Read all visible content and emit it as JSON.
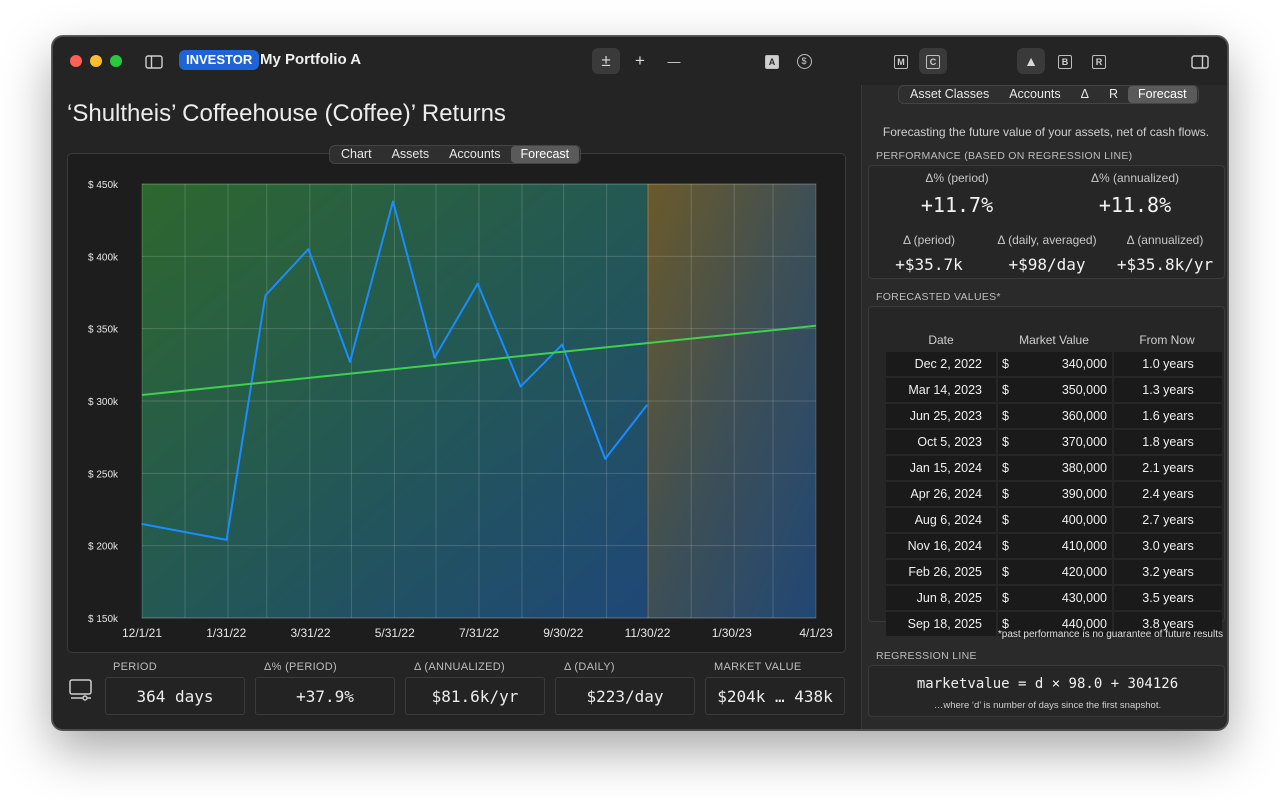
{
  "app": {
    "badge": "INVESTOR",
    "portfolio_name": "My Portfolio A",
    "accent_color": "#1f64d4"
  },
  "toolbar": {
    "icons": [
      "sidebar-toggle-icon",
      "plus-minus-icon",
      "plus-icon",
      "minus-icon",
      "a-box-icon",
      "dollar-circle-icon",
      "m-box-icon",
      "c-box-icon",
      "triangle-icon",
      "b-box-icon",
      "r-box-icon",
      "inspector-toggle-icon"
    ],
    "plus_minus": "±",
    "plus": "+",
    "minus": "—",
    "box_a": "A",
    "dollar": "$",
    "box_m": "M",
    "box_c": "C",
    "triangle": "▲",
    "box_b": "B",
    "box_r": "R"
  },
  "main": {
    "title": "‘Shultheis’ Coffeehouse (Coffee)’ Returns",
    "tabs": [
      {
        "label": "Chart",
        "active": false
      },
      {
        "label": "Assets",
        "active": false
      },
      {
        "label": "Accounts",
        "active": false
      },
      {
        "label": "Forecast",
        "active": true
      }
    ]
  },
  "chart_data": {
    "type": "line",
    "x_ticks": [
      "12/1/21",
      "1/31/22",
      "3/31/22",
      "5/31/22",
      "7/31/22",
      "9/30/22",
      "11/30/22",
      "1/30/23",
      "4/1/23"
    ],
    "y_ticks": [
      "$  450k",
      "$  400k",
      "$  350k",
      "$  300k",
      "$  250k",
      "$  200k",
      "$  150k"
    ],
    "ylim": [
      150000,
      450000
    ],
    "xlim": [
      "2021-12-01",
      "2023-04-01"
    ],
    "forecast_region_start": "2022-11-30",
    "series": [
      {
        "type": "market-value",
        "color": "#1a8cff",
        "points": [
          [
            "2021-12-01",
            215000
          ],
          [
            "2022-01-31",
            204000
          ],
          [
            "2022-02-28",
            373000
          ],
          [
            "2022-03-31",
            405000
          ],
          [
            "2022-04-30",
            327000
          ],
          [
            "2022-05-31",
            438000
          ],
          [
            "2022-06-30",
            330000
          ],
          [
            "2022-07-31",
            381000
          ],
          [
            "2022-08-31",
            310000
          ],
          [
            "2022-09-30",
            339000
          ],
          [
            "2022-10-31",
            260000
          ],
          [
            "2022-11-30",
            297000
          ]
        ]
      },
      {
        "type": "regression",
        "color": "#3fd04e",
        "points": [
          [
            "2021-12-01",
            304126
          ],
          [
            "2023-04-01",
            352000
          ]
        ]
      }
    ]
  },
  "stats": {
    "icon": "desktop-icon",
    "items": [
      {
        "label": "PERIOD",
        "value": "364 days"
      },
      {
        "label": "Δ% (PERIOD)",
        "value": "+37.9%"
      },
      {
        "label": "Δ (ANNUALIZED)",
        "value": "$81.6k/yr"
      },
      {
        "label": "Δ (DAILY)",
        "value": "$223/day"
      },
      {
        "label": "MARKET VALUE",
        "value": "$204k … 438k"
      }
    ]
  },
  "sidebar": {
    "tabs": [
      {
        "label": "Asset Classes",
        "active": false
      },
      {
        "label": "Accounts",
        "active": false
      },
      {
        "label": "Δ",
        "active": false
      },
      {
        "label": "R",
        "active": false
      },
      {
        "label": "Forecast",
        "active": true
      }
    ],
    "description": "Forecasting the future value of your assets, net of cash flows.",
    "performance": {
      "heading": "PERFORMANCE (BASED ON REGRESSION LINE)",
      "pct_period_label": "Δ% (period)",
      "pct_period": "+11.7%",
      "pct_annual_label": "Δ% (annualized)",
      "pct_annual": "+11.8%",
      "d_period_label": "Δ (period)",
      "d_period": "+$35.7k",
      "d_daily_label": "Δ (daily, averaged)",
      "d_daily": "+$98/day",
      "d_annual_label": "Δ (annualized)",
      "d_annual": "+$35.8k/yr"
    },
    "forecast": {
      "heading": "FORECASTED VALUES*",
      "columns": [
        "Date",
        "Market Value",
        "From Now"
      ],
      "currency": "$",
      "rows": [
        {
          "date": "Dec 2, 2022",
          "value": "340,000",
          "from_now": "1.0 years"
        },
        {
          "date": "Mar 14, 2023",
          "value": "350,000",
          "from_now": "1.3 years"
        },
        {
          "date": "Jun 25, 2023",
          "value": "360,000",
          "from_now": "1.6 years"
        },
        {
          "date": "Oct 5, 2023",
          "value": "370,000",
          "from_now": "1.8 years"
        },
        {
          "date": "Jan 15, 2024",
          "value": "380,000",
          "from_now": "2.1 years"
        },
        {
          "date": "Apr 26, 2024",
          "value": "390,000",
          "from_now": "2.4 years"
        },
        {
          "date": "Aug 6, 2024",
          "value": "400,000",
          "from_now": "2.7 years"
        },
        {
          "date": "Nov 16, 2024",
          "value": "410,000",
          "from_now": "3.0 years"
        },
        {
          "date": "Feb 26, 2025",
          "value": "420,000",
          "from_now": "3.2 years"
        },
        {
          "date": "Jun 8, 2025",
          "value": "430,000",
          "from_now": "3.5 years"
        },
        {
          "date": "Sep 18, 2025",
          "value": "440,000",
          "from_now": "3.8 years"
        }
      ],
      "disclaimer": "*past performance is no guarantee of future results"
    },
    "regression": {
      "heading": "REGRESSION LINE",
      "formula": "marketvalue = d × 98.0 + 304126",
      "note": "…where ‘d’ is number of days since the first snapshot."
    }
  }
}
